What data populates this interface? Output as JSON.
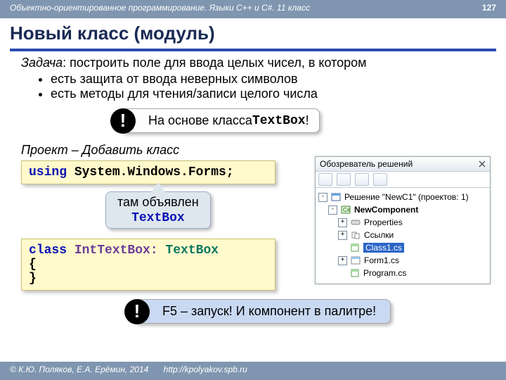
{
  "header": {
    "breadcrumb": "Объектно-ориентированное программирование. Языки C++ и C#. 11 класс",
    "page_number": "127"
  },
  "title": "Новый класс (модуль)",
  "task": {
    "label": "Задача",
    "text": ": построить поле для ввода целых чисел, в котором",
    "bullets": [
      "есть защита от ввода неверных символов",
      "есть методы для чтения/записи целого числа"
    ]
  },
  "callout1": {
    "bang": "!",
    "prefix": "На основе класса ",
    "code": "TextBox",
    "suffix": "!"
  },
  "project_hint": "Проект – Добавить класс",
  "code1": {
    "kw": "using",
    "rest": " System.Windows.Forms;"
  },
  "tip": {
    "line1": "там объявлен",
    "code": "TextBox"
  },
  "code2": {
    "kw_class": "class",
    "name": " IntTextBox: ",
    "base": "TextBox",
    "open": "{",
    "close": "}"
  },
  "callout2": {
    "bang": "!",
    "text": "F5 – запуск! И компонент в палитре!"
  },
  "explorer": {
    "title": "Обозреватель решений",
    "solution_label": "Решение \"NewC1\" (проектов: 1)",
    "project": "NewComponent",
    "nodes": {
      "properties": "Properties",
      "references": "Ссылки",
      "class1": "Class1.cs",
      "form1": "Form1.cs",
      "program": "Program.cs"
    }
  },
  "footer": {
    "copyright": "© К.Ю. Поляков, Е.А. Ерёмин, 2014",
    "url": "http://kpolyakov.spb.ru"
  }
}
